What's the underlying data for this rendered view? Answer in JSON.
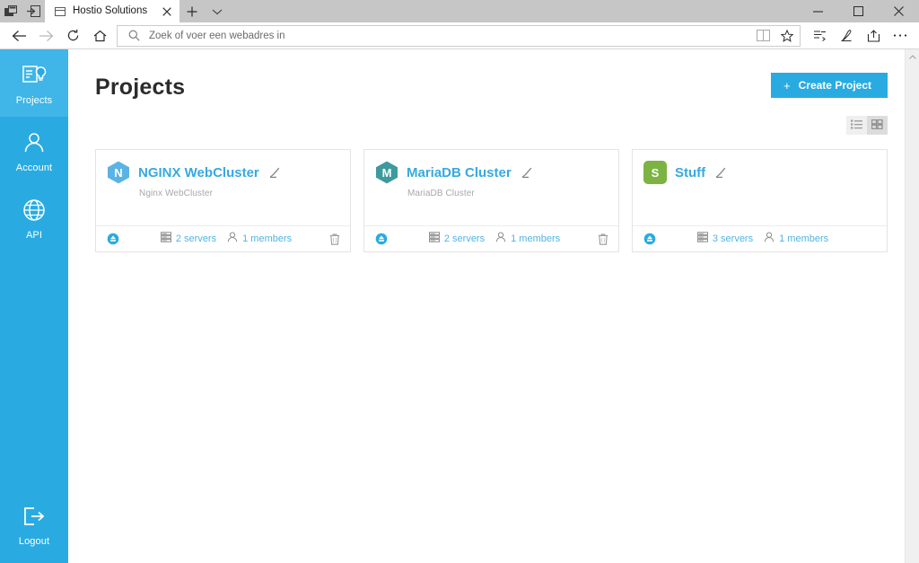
{
  "browser": {
    "set_aside_button": "Show tabs you have set aside",
    "set_tabs_aside_button": "Set these tabs aside",
    "tab_title": "Hostio Solutions",
    "tab_close": "Close tab",
    "new_tab": "New tab",
    "tab_menu": "Tab options",
    "back": "Back",
    "forward": "Forward",
    "refresh": "Refresh",
    "home": "Home",
    "address_placeholder": "Zoek of voer een webadres in",
    "reading_view": "Reading view",
    "favorite": "Add to favorites",
    "hub": "Hub",
    "notes": "Make a Web Note",
    "share": "Share",
    "more": "Settings and more",
    "minimize": "Minimize",
    "maximize": "Maximize",
    "close": "Close"
  },
  "sidebar": {
    "items": [
      {
        "label": "Projects",
        "icon": "projects-icon",
        "active": true
      },
      {
        "label": "Account",
        "icon": "account-icon",
        "active": false
      },
      {
        "label": "API",
        "icon": "api-icon",
        "active": false
      }
    ],
    "logout": {
      "label": "Logout",
      "icon": "logout-icon"
    }
  },
  "page": {
    "title": "Projects",
    "create_button": {
      "plus": "+",
      "label": "Create Project"
    },
    "view_toggle": {
      "list_label": "List view",
      "grid_label": "Grid view",
      "active": "grid"
    }
  },
  "projects": [
    {
      "initial": "N",
      "avatar_shape": "hexagon",
      "avatar_color": "#5BB3E4",
      "name": "NGINX WebCluster",
      "description": "Nginx WebCluster",
      "servers": "2 servers",
      "members": "1 members",
      "has_delete": true,
      "status_icon": "deploy-status-icon",
      "edit_icon": "edit-pencil-icon",
      "servers_icon": "server-stack-icon",
      "members_icon": "user-icon",
      "delete_icon": "trash-icon"
    },
    {
      "initial": "M",
      "avatar_shape": "hexagon",
      "avatar_color": "#3E9A9C",
      "name": "MariaDB Cluster",
      "description": "MariaDB Cluster",
      "servers": "2 servers",
      "members": "1 members",
      "has_delete": true,
      "status_icon": "deploy-status-icon",
      "edit_icon": "edit-pencil-icon",
      "servers_icon": "server-stack-icon",
      "members_icon": "user-icon",
      "delete_icon": "trash-icon"
    },
    {
      "initial": "S",
      "avatar_shape": "square",
      "avatar_color": "#7CB342",
      "name": "Stuff",
      "description": "",
      "servers": "3 servers",
      "members": "1 members",
      "has_delete": false,
      "status_icon": "deploy-status-icon",
      "edit_icon": "edit-pencil-icon",
      "servers_icon": "server-stack-icon",
      "members_icon": "user-icon",
      "delete_icon": "trash-icon"
    }
  ],
  "colors": {
    "accent": "#29ABE2",
    "accent_light": "#3FB5E8",
    "link": "#37A9E0",
    "stat_link": "#4FB4E4",
    "title": "#2b2b2b",
    "muted": "#a8a8a8"
  }
}
